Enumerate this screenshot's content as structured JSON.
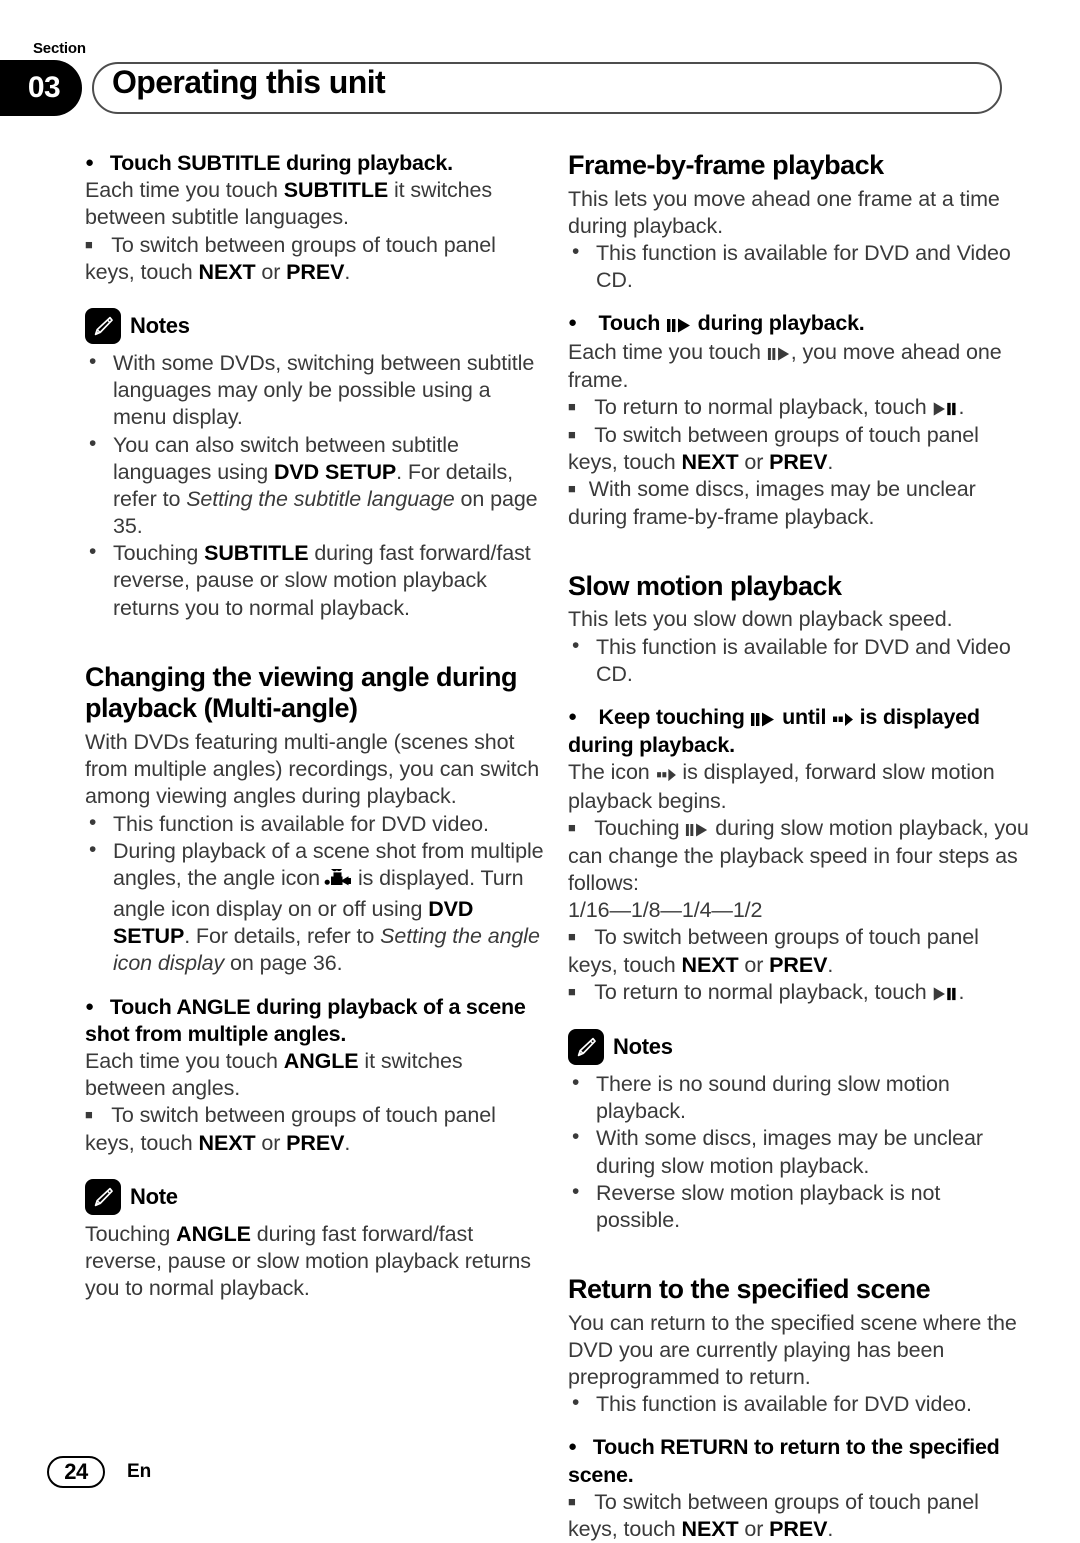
{
  "header": {
    "section_word": "Section",
    "section_number": "03",
    "title": "Operating this unit"
  },
  "footer": {
    "page_number": "24",
    "language": "En"
  },
  "icons": {
    "note_icon": "pencil-icon",
    "angle_icon": "movie-camera-icon",
    "step_forward_icon": "pause-play-icon",
    "play_pause_icon": "play-pause-icon",
    "slow_motion_icon": "slow-forward-icon"
  },
  "left_column": {
    "subtitle_action": "Touch SUBTITLE during playback.",
    "subtitle_body_1": "Each time you touch ",
    "subtitle_body_1_bold": "SUBTITLE",
    "subtitle_body_1_end": " it switches between subtitle languages.",
    "subtitle_sq_1": "To switch between groups of touch panel keys, touch ",
    "next_label": "NEXT",
    "or_label": " or ",
    "prev_label": "PREV",
    "notes_label_plural": "Notes",
    "note_label_singular": "Note",
    "notes_1": [
      "With some DVDs, switching between subtitle languages may only be possible using a menu display.",
      "You can also switch between subtitle languages using DVD SETUP. For details, refer to Setting the subtitle language on page 35.",
      "Touching SUBTITLE during fast forward/fast reverse, pause or slow motion playback returns you to normal playback."
    ],
    "angle_heading": "Changing the viewing angle during playback (Multi-angle)",
    "angle_intro": "With DVDs featuring multi-angle (scenes shot from multiple angles) recordings, you can switch among viewing angles during playback.",
    "angle_bullet_1": "This function is available for DVD video.",
    "angle_bullet_2_a": "During playback of a scene shot from multiple angles, the angle icon",
    "angle_bullet_2_b": "is displayed. Turn angle icon display on or off using ",
    "angle_bullet_2_bold": "DVD SETUP",
    "angle_bullet_2_c": ". For details, refer to ",
    "angle_bullet_2_italic": "Setting the angle icon display",
    "angle_bullet_2_d": " on page 36.",
    "angle_action": "Touch ANGLE during playback of a scene shot from multiple angles.",
    "angle_body_a": "Each time you touch ",
    "angle_body_bold": "ANGLE",
    "angle_body_b": " it switches between angles.",
    "angle_note": "Touching ANGLE during fast forward/fast reverse, pause or slow motion playback returns you to normal playback."
  },
  "right_column": {
    "frame_heading": "Frame-by-frame playback",
    "frame_intro": "This lets you move ahead one frame at a time during playback.",
    "frame_bullet_1": "This function is available for DVD and Video CD.",
    "frame_action_a": "Touch",
    "frame_action_b": "during playback.",
    "frame_body_a": "Each time you touch",
    "frame_body_b": ", you move ahead one frame.",
    "frame_sq_1_a": "To return to normal playback, touch",
    "frame_sq_1_b": ".",
    "frame_sq_2": "To switch between groups of touch panel keys, touch ",
    "frame_sq_3": "With some discs, images may be unclear during frame-by-frame playback.",
    "slow_heading": "Slow motion playback",
    "slow_intro": "This lets you slow down playback speed.",
    "slow_bullet_1": "This function is available for DVD and Video CD.",
    "slow_action_a": "Keep touching",
    "slow_action_b": "until",
    "slow_action_c": "is displayed during playback.",
    "slow_body_a": "The icon",
    "slow_body_b": "is displayed, forward slow motion playback begins.",
    "slow_sq_1_a": "Touching",
    "slow_sq_1_b": "during slow motion playback, you can change the playback speed in four steps as follows:",
    "slow_speeds": "1/16—1/8—1/4—1/2",
    "slow_sq_2": "To switch between groups of touch panel keys, touch ",
    "slow_sq_3_a": "To return to normal playback, touch",
    "slow_notes": [
      "There is no sound during slow motion playback.",
      "With some discs, images may be unclear during slow motion playback.",
      "Reverse slow motion playback is not possible."
    ],
    "return_heading": "Return to the specified scene",
    "return_intro": "You can return to the specified scene where the DVD you are currently playing has been preprogrammed to return.",
    "return_bullet_1": "This function is available for DVD video.",
    "return_action": "Touch RETURN to return to the specified scene.",
    "return_sq_1": "To switch between groups of touch panel keys, touch ",
    "next_label": "NEXT",
    "or_label": " or ",
    "prev_label": "PREV"
  }
}
